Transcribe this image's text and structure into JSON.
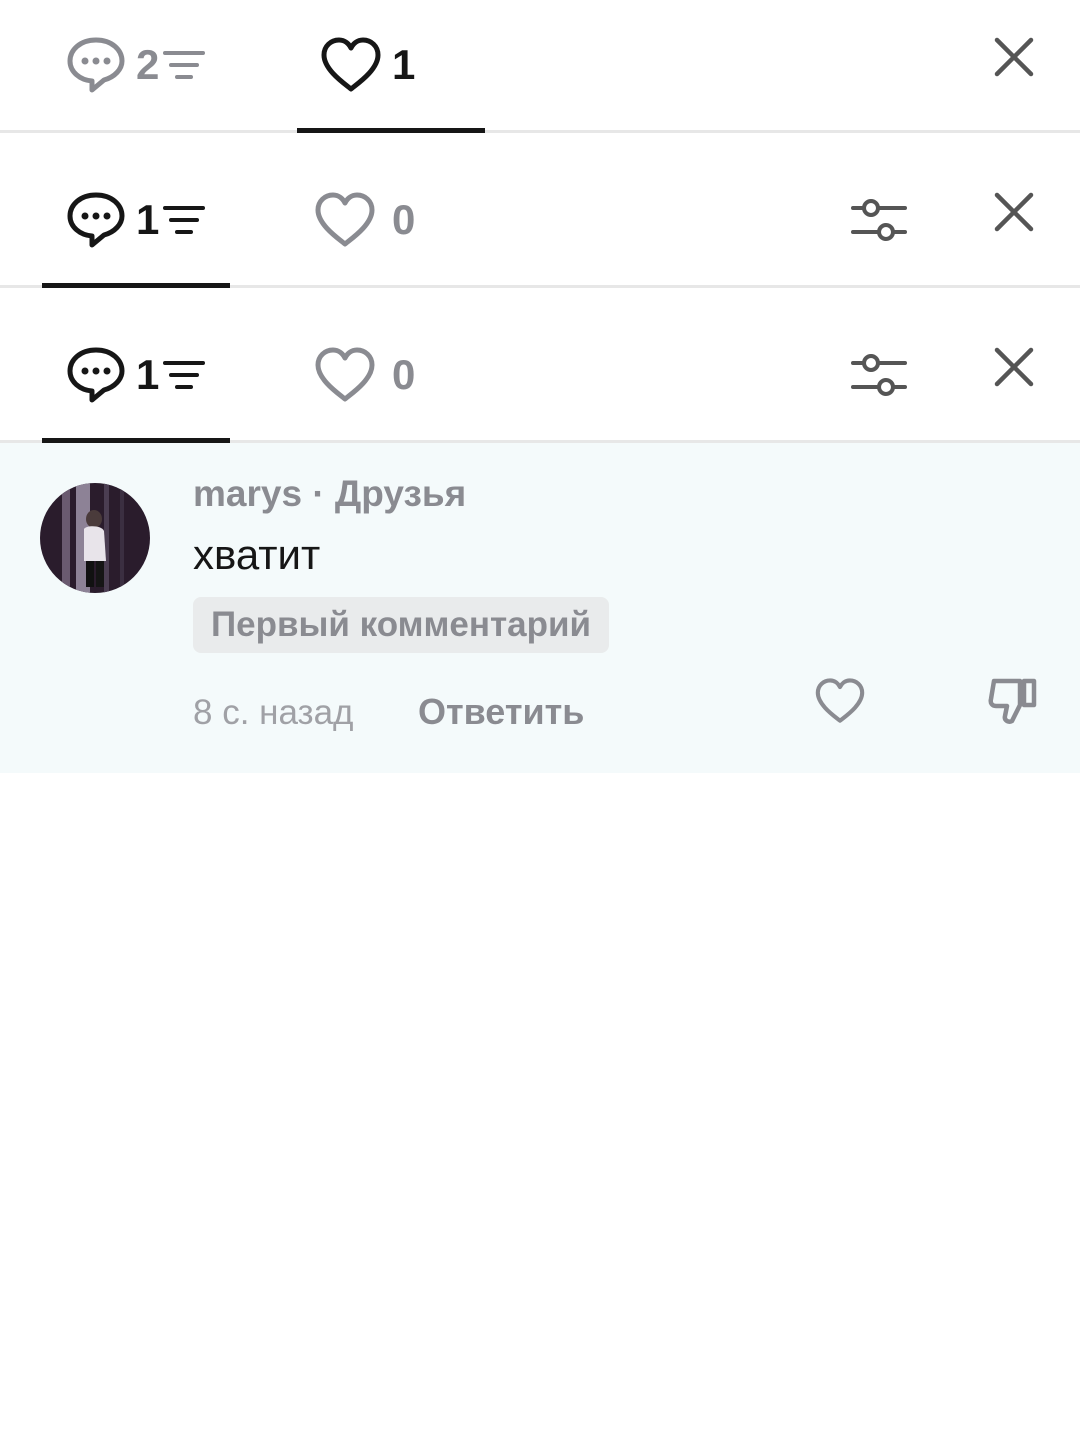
{
  "bars": [
    {
      "comments_count": "2",
      "likes_count": "1",
      "active": "likes"
    },
    {
      "comments_count": "1",
      "likes_count": "0",
      "active": "comments"
    },
    {
      "comments_count": "1",
      "likes_count": "0",
      "active": "comments"
    }
  ],
  "comment": {
    "author": "marys",
    "relation": "Друзья",
    "separator": "·",
    "text": "хватит",
    "badge": "Первый комментарий",
    "time": "8 с. назад",
    "reply_label": "Ответить"
  },
  "colors": {
    "active": "#161616",
    "inactive": "#8a8b91",
    "comment_bg": "#f4fafb"
  },
  "icons": [
    "comment-icon",
    "sort-icon",
    "heart-icon",
    "filter-icon",
    "close-icon",
    "dislike-icon"
  ]
}
